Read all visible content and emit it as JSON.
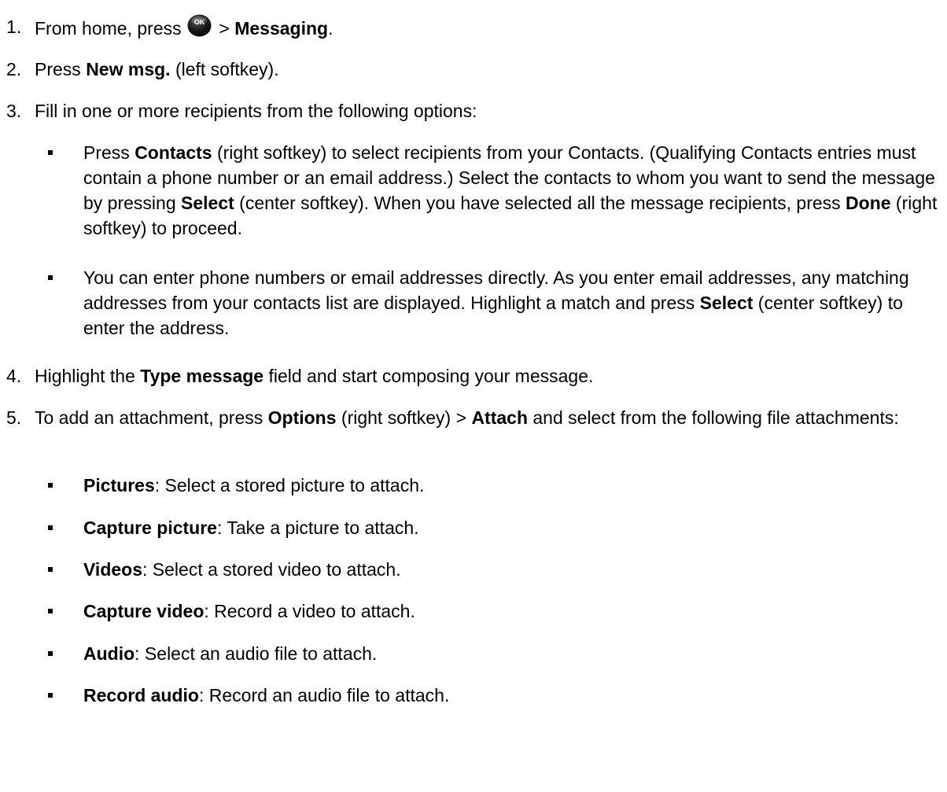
{
  "steps": [
    {
      "number": "1.",
      "pre": "From home, press ",
      "icon": "ok-key-icon",
      "icon_text": "OK",
      "mid": " > ",
      "bold": "Messaging",
      "post": "."
    },
    {
      "number": "2.",
      "pre": "Press ",
      "bold": "New msg.",
      "post": " (left softkey)."
    },
    {
      "number": "3.",
      "text": "Fill in one or more recipients from the following options:"
    },
    {
      "number": "4.",
      "pre": "Highlight the ",
      "bold": "Type message",
      "post": " field and start composing your message."
    },
    {
      "number": "5.",
      "pre": "To add an attachment, press ",
      "bold1": "Options",
      "mid": " (right softkey) > ",
      "bold2": "Attach",
      "post": " and select from the following file attachments:"
    }
  ],
  "recipient_options": [
    {
      "t1": "Press ",
      "b1": "Contacts",
      "t2": " (right softkey) to select recipients from your Contacts. (Qualifying Contacts entries must contain a phone number or an email address.) Select the contacts to whom you want to send the message by pressing ",
      "b2": "Select",
      "t3": " (center softkey). When you have selected all the message recipients, press ",
      "b3": "Done",
      "t4": " (right softkey) to proceed."
    },
    {
      "t1": "You can enter phone numbers or email addresses directly. As you enter email addresses, any matching addresses from your contacts list are displayed. Highlight a match and press ",
      "b1": "Select",
      "t2": " (center softkey) to enter the address."
    }
  ],
  "attachments": [
    {
      "name": "Pictures",
      "desc": ": Select a stored picture to attach."
    },
    {
      "name": "Capture picture",
      "desc": ": Take a picture to attach."
    },
    {
      "name": "Videos",
      "desc": ": Select a stored video to attach."
    },
    {
      "name": "Capture video",
      "desc": ": Record a video to attach."
    },
    {
      "name": "Audio",
      "desc": ": Select an audio file to attach."
    },
    {
      "name": "Record audio",
      "desc": ": Record an audio file to attach."
    }
  ]
}
